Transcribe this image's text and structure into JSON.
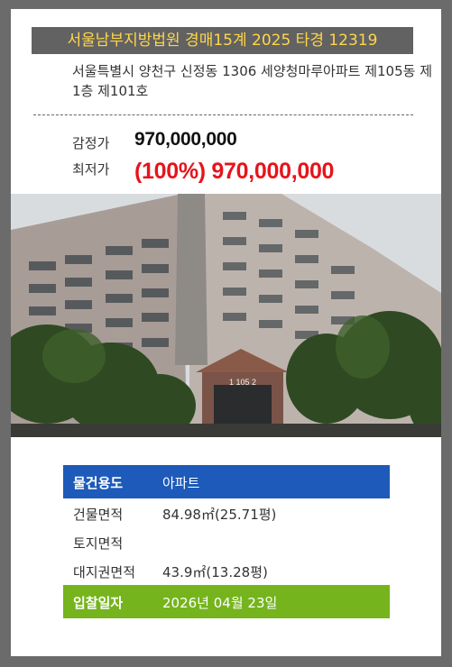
{
  "listing": {
    "case_title": "서울남부지방법원 경매15계 2025 타경 12319",
    "address": "서울특별시 양천구 신정동 1306 세양청마루아파트 제105동 제1층 제101호",
    "appraisal_label": "감정가",
    "appraisal_value": "970,000,000",
    "min_price_label": "최저가",
    "min_price_value": "(100%) 970,000,000",
    "building_sign": "1 105 2"
  },
  "info": {
    "usage_label": "물건용도",
    "usage_value": "아파트",
    "building_area_label": "건물면적",
    "building_area_value": "84.98㎡(25.71평)",
    "land_area_label": "토지면적",
    "land_area_value": "",
    "land_right_label": "대지권면적",
    "land_right_value": "43.9㎡(13.28평)",
    "bid_date_label": "입찰일자",
    "bid_date_value": "2026년 04월 23일"
  },
  "colors": {
    "banner_bg": "#626262",
    "banner_text": "#ffd64a",
    "min_price": "#e6141b",
    "usage_row": "#1d5ab9",
    "bid_row": "#75b41d"
  }
}
